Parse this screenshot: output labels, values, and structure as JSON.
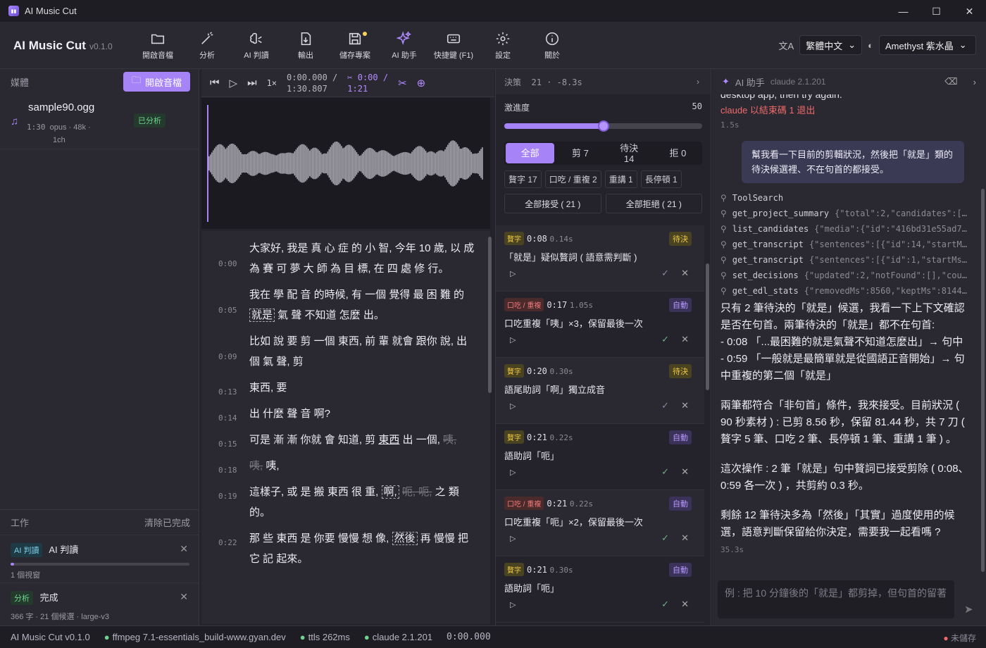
{
  "app": {
    "window_title": "AI Music Cut",
    "brand": "AI Music Cut",
    "version": "v0.1.0"
  },
  "toolbar": {
    "open_audio": "開啟音檔",
    "analyze": "分析",
    "ai_judge": "AI 判讀",
    "export": "輸出",
    "save_project": "儲存專案",
    "ai_assistant": "AI 助手",
    "shortcuts": "快捷鍵 (F1)",
    "settings": "設定",
    "about": "關於",
    "language": "繁體中文",
    "theme": "Amethyst 紫水晶"
  },
  "media": {
    "header": "媒體",
    "open_button": "開啟音檔",
    "file": {
      "name": "sample90.ogg",
      "duration": "1:30",
      "codec": "opus · 48k ·",
      "channels": "1ch",
      "status": "已分析"
    }
  },
  "jobs": {
    "header": "工作",
    "clear": "清除已完成",
    "items": [
      {
        "tag": "AI 判讀",
        "title": "AI 判讀",
        "sub": "1 個視窗",
        "progress": 0.02
      },
      {
        "tag": "分析",
        "title": "完成",
        "sub": "366 字 · 21 個候選 · large-v3"
      }
    ]
  },
  "player": {
    "rate": "1×",
    "time": "0:00.000 /",
    "total": "1:30.807",
    "cut": "✂ 0:00 /",
    "cut_total": "1:21"
  },
  "transcript": [
    {
      "ts": "0:00",
      "parts": [
        {
          "t": "大家好, 我是 真 心 症 的 小 智, 今年 10 歲, 以 成 為 賽 可 夢 大 師 為 目 標, 在 四 處 修 行。"
        }
      ]
    },
    {
      "ts": "0:05",
      "parts": [
        {
          "t": "我在 學 配 音 的時候, 有 一個 覺得 最 困 難 的 "
        },
        {
          "t": "就是",
          "k": "hl"
        },
        {
          "t": " 氣 聲 不知道 怎麼 出。"
        }
      ]
    },
    {
      "ts": "0:09",
      "parts": [
        {
          "t": "比如 說 要 剪 一個 東西, 前 輩 就會 跟你 說, 出 個 氣 聲, 剪"
        }
      ]
    },
    {
      "ts": "0:13",
      "parts": [
        {
          "t": "東西, 要"
        }
      ]
    },
    {
      "ts": "0:14",
      "parts": [
        {
          "t": "出 什麼 聲 音 啊?"
        }
      ]
    },
    {
      "ts": "0:15",
      "parts": [
        {
          "t": "可是 漸 漸 你就 會 知道, 剪 "
        },
        {
          "t": "東西",
          "k": "u"
        },
        {
          "t": " 出 一個, "
        },
        {
          "t": "咦,",
          "k": "del"
        }
      ]
    },
    {
      "ts": "0:18",
      "parts": [
        {
          "t": "咦,",
          "k": "del"
        },
        {
          "t": " 咦,"
        }
      ]
    },
    {
      "ts": "0:19",
      "parts": [
        {
          "t": "這樣子, 或 是 搬 東西 很 重, "
        },
        {
          "t": "啊,",
          "k": "hl"
        },
        {
          "t": " "
        },
        {
          "t": "呃, 呃,",
          "k": "del"
        },
        {
          "t": " 之 類 的。"
        }
      ]
    },
    {
      "ts": "0:22",
      "parts": [
        {
          "t": "那 些 東西 是 你要 慢慢 想 像, "
        },
        {
          "t": "然後",
          "k": "hl"
        },
        {
          "t": " 再 慢慢 把它 記 起來。"
        }
      ]
    }
  ],
  "decisions": {
    "header": "決策",
    "count": "21",
    "saved": "-8.3s",
    "aggressiveness_label": "激進度",
    "aggressiveness": 50,
    "tabs": {
      "all": "全部",
      "cut": "剪 7",
      "pending": "待決",
      "pending_count": "14",
      "reject": "拒 0"
    },
    "chips": [
      "贅字 17",
      "口吃 / 重複 2",
      "重講 1",
      "長停頓 1"
    ],
    "accept_all": "全部接受 ( 21 )",
    "reject_all": "全部拒絕 ( 21 )",
    "candidates": [
      {
        "tag": "贅字",
        "tagc": "y",
        "time": "0:08",
        "dur": "0.14s",
        "status": "待決",
        "sc": "p",
        "desc": "「就是」疑似贅詞 ( 語意需判斷 )",
        "ok": false
      },
      {
        "tag": "口吃 / 重複",
        "tagc": "r",
        "time": "0:17",
        "dur": "1.05s",
        "status": "自動",
        "sc": "a",
        "desc": "口吃重複「咦」×3，保留最後一次",
        "ok": true
      },
      {
        "tag": "贅字",
        "tagc": "y",
        "time": "0:20",
        "dur": "0.30s",
        "status": "待決",
        "sc": "p",
        "desc": "語尾助詞「啊」獨立成音",
        "ok": false
      },
      {
        "tag": "贅字",
        "tagc": "y",
        "time": "0:21",
        "dur": "0.22s",
        "status": "自動",
        "sc": "a",
        "desc": "語助詞「呃」",
        "ok": true
      },
      {
        "tag": "口吃 / 重複",
        "tagc": "r",
        "time": "0:21",
        "dur": "0.22s",
        "status": "自動",
        "sc": "a",
        "desc": "口吃重複「呃」×2，保留最後一次",
        "ok": true
      },
      {
        "tag": "贅字",
        "tagc": "y",
        "time": "0:21",
        "dur": "0.30s",
        "status": "自動",
        "sc": "a",
        "desc": "語助詞「呃」",
        "ok": true
      }
    ]
  },
  "ai": {
    "title": "AI 助手",
    "version": "claude 2.1.201",
    "prev_text": "desktop app, then try again.",
    "error": "claude 以結束碼 1 退出",
    "error_time": "1.5s",
    "user_msg": "幫我看一下目前的剪輯狀況，然後把「就是」類的待決候選裡、不在句首的都接受。",
    "tools": [
      {
        "name": "ToolSearch",
        "args": ""
      },
      {
        "name": "get_project_summary",
        "args": "{\"total\":2,\"candidates\":[{\"id\":\"filler:..."
      },
      {
        "name": "list_candidates",
        "args": "{\"media\":{\"id\":\"416bd31e55ad7387\",\"na..."
      },
      {
        "name": "get_transcript",
        "args": "{\"sentences\":[{\"id\":14,\"startMs\":52740,\"e..."
      },
      {
        "name": "get_transcript",
        "args": "{\"sentences\":[{\"id\":1,\"startMs\":5970,\"end..."
      },
      {
        "name": "set_decisions",
        "args": "{\"updated\":2,\"notFound\":[],\"counts\":{\"auto..."
      },
      {
        "name": "get_edl_stats",
        "args": "{\"removedMs\":8560,\"keptMs\":81440,\"cutC..."
      }
    ],
    "reply": [
      "只有 2 筆待決的「就是」候選，我看一下上下文確認是否在句首。兩筆待決的「就是」都不在句首:\n- 0:08 「...最困難的就是氣聲不知道怎麼出」→ 句中\n- 0:59 「一般就是最簡單就是從國語正音開始」→ 句中重複的第二個「就是」",
      "兩筆都符合「非句首」條件，我來接受。目前狀況 ( 90 秒素材 ) : 已剪 8.56 秒，保留 81.44 秒，共 7 刀 ( 贅字 5 筆、口吃 2 筆、長停頓 1 筆、重講 1 筆 ) 。",
      "這次操作 : 2 筆「就是」句中贅詞已接受剪除 ( 0:08、0:59 各一次 ) ，共剪約 0.3 秒。",
      "剩餘 12 筆待決多為「然後」「其實」過度使用的候選，語意判斷保留給你決定，需要我一起看嗎 ?"
    ],
    "reply_time": "35.3s",
    "input_placeholder": "例 : 把 10 分鐘後的「就是」都剪掉，但句首的留著"
  },
  "status": {
    "app": "AI Music Cut v0.1.0",
    "ffmpeg": "ffmpeg 7.1-essentials_build-www.gyan.dev",
    "ttls": "ttls 262ms",
    "claude": "claude 2.1.201",
    "time": "0:00.000",
    "unsaved": "未儲存"
  },
  "colors": {
    "accent": "#a683f6",
    "background": "#24232b",
    "panel": "#2a2931"
  }
}
